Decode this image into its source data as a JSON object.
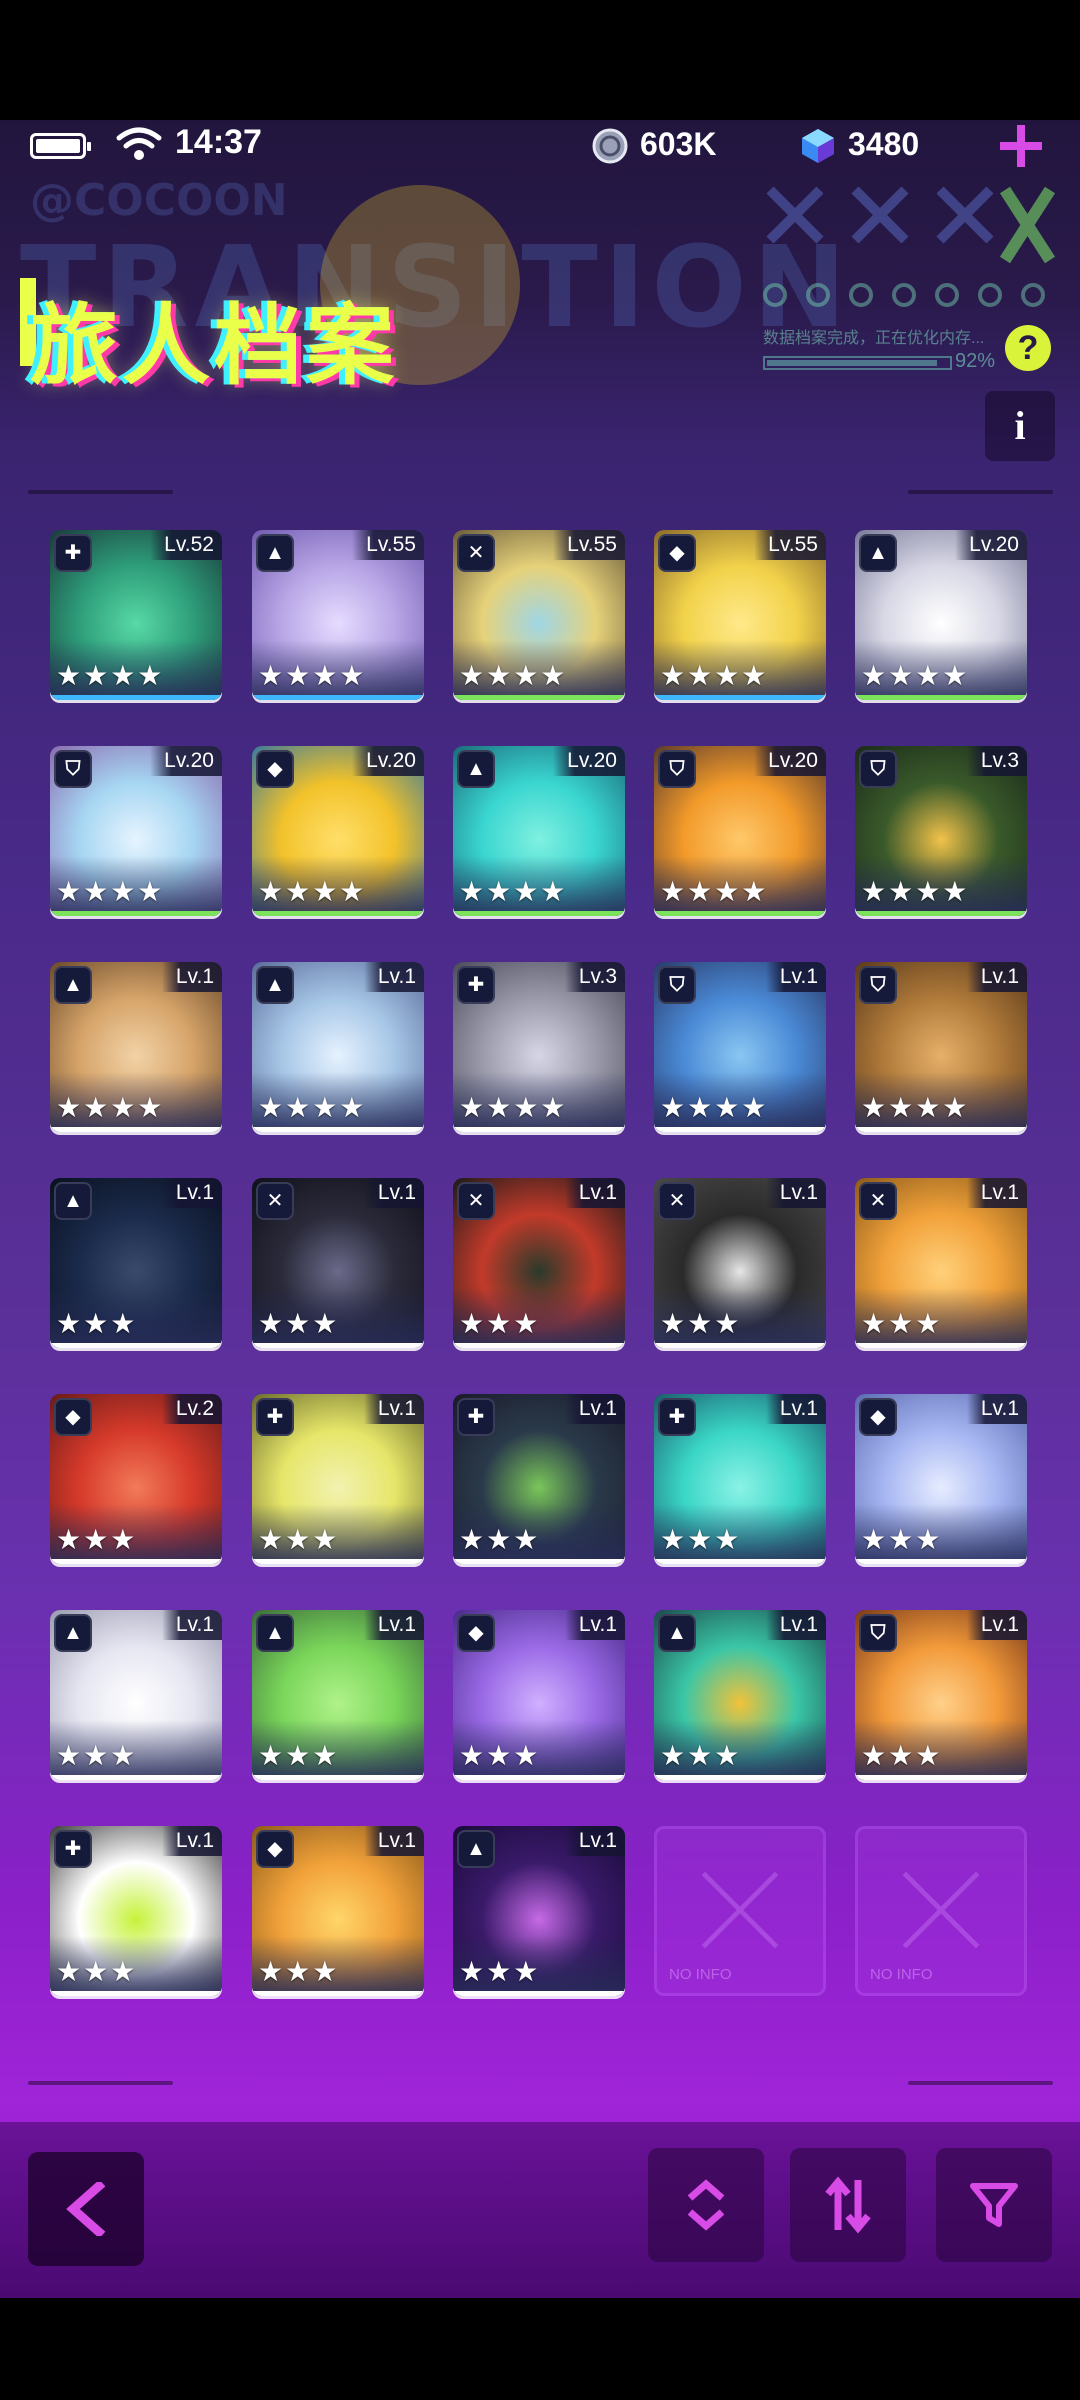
{
  "status": {
    "time": "14:37"
  },
  "resources": {
    "coins": "603K",
    "gems": "3480"
  },
  "header": {
    "title": "旅人档案",
    "bg_cocoon": "@COCOON",
    "bg_transition": "TRANSITION",
    "loading_text": "数据档案完成，正在优化内存...",
    "loading_percent": "92%",
    "help_label": "?",
    "info_label": "i"
  },
  "colors": {
    "accent": "#d94be6",
    "title": "#eaff4a",
    "strip_cyan": "#3fb7ff",
    "strip_green": "#7be35a"
  },
  "cards": [
    {
      "level": "Lv.52",
      "stars": "★★★★",
      "role_icon": "heal-icon",
      "strip": "cyan",
      "art": [
        "#2e9e7a",
        "#58d9a6",
        "#1a3a3a"
      ]
    },
    {
      "level": "Lv.55",
      "stars": "★★★★",
      "role_icon": "arrow-up-icon",
      "strip": "cyan",
      "art": [
        "#b8a6e6",
        "#e6dcff",
        "#6f5ab0"
      ]
    },
    {
      "level": "Lv.55",
      "stars": "★★★★",
      "role_icon": "swords-icon",
      "strip": "green",
      "art": [
        "#e6d27a",
        "#9fd6e6",
        "#6a5a3a"
      ]
    },
    {
      "level": "Lv.55",
      "stars": "★★★★",
      "role_icon": "diamond-icon",
      "strip": "cyan",
      "art": [
        "#f2d24a",
        "#ffe98a",
        "#8a6a2a"
      ]
    },
    {
      "level": "Lv.20",
      "stars": "★★★★",
      "role_icon": "arrow-up-icon",
      "strip": "green",
      "art": [
        "#d8d8e6",
        "#ffffff",
        "#7a7a9a"
      ]
    },
    {
      "level": "Lv.20",
      "stars": "★★★★",
      "role_icon": "shield-icon",
      "strip": "green",
      "art": [
        "#a6d6f2",
        "#e6f4ff",
        "#8a6ab0"
      ]
    },
    {
      "level": "Lv.20",
      "stars": "★★★★",
      "role_icon": "diamond-icon",
      "strip": "green",
      "art": [
        "#f2c22a",
        "#ffdf6a",
        "#3a7a9a"
      ]
    },
    {
      "level": "Lv.20",
      "stars": "★★★★",
      "role_icon": "arrow-up-icon",
      "strip": "green",
      "art": [
        "#3ad6d0",
        "#7ff0e0",
        "#1a6a7a"
      ]
    },
    {
      "level": "Lv.20",
      "stars": "★★★★",
      "role_icon": "shield-icon",
      "strip": "green",
      "art": [
        "#f29a2a",
        "#ffc86a",
        "#5a3a2a"
      ]
    },
    {
      "level": "Lv.3",
      "stars": "★★★★",
      "role_icon": "shield-icon",
      "strip": "green",
      "art": [
        "#3a5a2a",
        "#f2c24a",
        "#1a2a1a"
      ]
    },
    {
      "level": "Lv.1",
      "stars": "★★★★",
      "role_icon": "arrow-up-icon",
      "strip": "white",
      "art": [
        "#d6a46a",
        "#f2d2a6",
        "#6a4a2a"
      ]
    },
    {
      "level": "Lv.1",
      "stars": "★★★★",
      "role_icon": "arrow-up-icon",
      "strip": "white",
      "art": [
        "#a6c6e6",
        "#e6f2ff",
        "#5a6a9a"
      ]
    },
    {
      "level": "Lv.3",
      "stars": "★★★★",
      "role_icon": "heal-icon",
      "strip": "white",
      "art": [
        "#9a9aaa",
        "#d6d6e6",
        "#4a4a5a"
      ]
    },
    {
      "level": "Lv.1",
      "stars": "★★★★",
      "role_icon": "shield-icon",
      "strip": "white",
      "art": [
        "#4a8ad6",
        "#8ac6f2",
        "#2a3a6a"
      ]
    },
    {
      "level": "Lv.1",
      "stars": "★★★★",
      "role_icon": "shield-icon",
      "strip": "white",
      "art": [
        "#b07a3a",
        "#e6b06a",
        "#5a3a1a"
      ]
    },
    {
      "level": "Lv.1",
      "stars": "★★★",
      "role_icon": "arrow-up-icon",
      "strip": "white",
      "art": [
        "#1a2a4a",
        "#3a4a6a",
        "#0a1020"
      ]
    },
    {
      "level": "Lv.1",
      "stars": "★★★",
      "role_icon": "swords-icon",
      "strip": "white",
      "art": [
        "#2a2a3a",
        "#6a6a8a",
        "#10101a"
      ]
    },
    {
      "level": "Lv.1",
      "stars": "★★★",
      "role_icon": "swords-icon",
      "strip": "white",
      "art": [
        "#c23a2a",
        "#2a3a2a",
        "#1a1a1a"
      ]
    },
    {
      "level": "Lv.1",
      "stars": "★★★",
      "role_icon": "swords-icon",
      "strip": "white",
      "art": [
        "#2a2a2a",
        "#e6e6e6",
        "#4a4a4a"
      ]
    },
    {
      "level": "Lv.1",
      "stars": "★★★",
      "role_icon": "swords-icon",
      "strip": "white",
      "art": [
        "#f2a23a",
        "#ffd07a",
        "#8a5a1a"
      ]
    },
    {
      "level": "Lv.2",
      "stars": "★★★",
      "role_icon": "diamond-icon",
      "strip": "white",
      "art": [
        "#d63a2a",
        "#f27a5a",
        "#6a1a1a"
      ]
    },
    {
      "level": "Lv.1",
      "stars": "★★★",
      "role_icon": "heal-icon",
      "strip": "white",
      "art": [
        "#e6e66a",
        "#f2f2b0",
        "#6a6a2a"
      ]
    },
    {
      "level": "Lv.1",
      "stars": "★★★",
      "role_icon": "heal-icon",
      "strip": "white",
      "art": [
        "#2a3a4a",
        "#7ac65a",
        "#1a1a2a"
      ]
    },
    {
      "level": "Lv.1",
      "stars": "★★★",
      "role_icon": "heal-icon",
      "strip": "white",
      "art": [
        "#3ad6c6",
        "#8af2e6",
        "#1a5a6a"
      ]
    },
    {
      "level": "Lv.1",
      "stars": "★★★",
      "role_icon": "diamond-icon",
      "strip": "white",
      "art": [
        "#a6b6f2",
        "#e6ecff",
        "#5a6ab0"
      ]
    },
    {
      "level": "Lv.1",
      "stars": "★★★",
      "role_icon": "arrow-up-icon",
      "strip": "white",
      "art": [
        "#e6e6f2",
        "#ffffff",
        "#9a9ab0"
      ]
    },
    {
      "level": "Lv.1",
      "stars": "★★★",
      "role_icon": "arrow-up-icon",
      "strip": "white",
      "art": [
        "#7ad65a",
        "#b0f28a",
        "#3a6a3a"
      ]
    },
    {
      "level": "Lv.1",
      "stars": "★★★",
      "role_icon": "diamond-icon",
      "strip": "white",
      "art": [
        "#9a6ae6",
        "#d0b0ff",
        "#4a2a8a"
      ]
    },
    {
      "level": "Lv.1",
      "stars": "★★★",
      "role_icon": "arrow-up-icon",
      "strip": "white",
      "art": [
        "#3ac6a6",
        "#f2c23a",
        "#1a4a4a"
      ]
    },
    {
      "level": "Lv.1",
      "stars": "★★★",
      "role_icon": "shield-icon",
      "strip": "white",
      "art": [
        "#f29a3a",
        "#ffd08a",
        "#7a3a1a"
      ]
    },
    {
      "level": "Lv.1",
      "stars": "★★★",
      "role_icon": "heal-icon",
      "strip": "white",
      "art": [
        "#ffffff",
        "#c6f23a",
        "#3a3a3a"
      ]
    },
    {
      "level": "Lv.1",
      "stars": "★★★",
      "role_icon": "diamond-icon",
      "strip": "white",
      "art": [
        "#f2a23a",
        "#ffd66a",
        "#8a5a1a"
      ]
    },
    {
      "level": "Lv.1",
      "stars": "★★★",
      "role_icon": "arrow-up-icon",
      "strip": "white",
      "art": [
        "#3a1a6a",
        "#c66ae6",
        "#1a0a3a"
      ]
    }
  ],
  "empty_slots": [
    {
      "label": "NO INFO"
    },
    {
      "label": "NO INFO"
    }
  ]
}
